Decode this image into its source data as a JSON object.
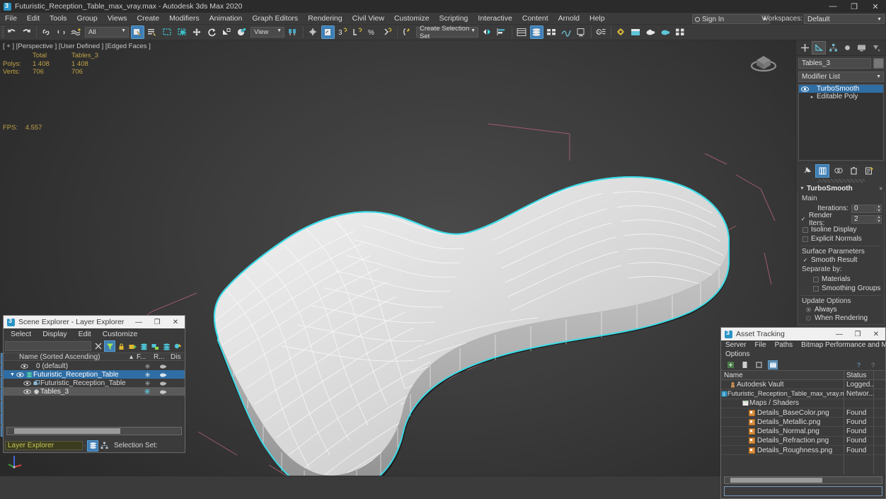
{
  "titlebar": {
    "title": "Futuristic_Reception_Table_max_vray.max - Autodesk 3ds Max 2020",
    "minimize": "—",
    "maximize": "❐",
    "close": "✕"
  },
  "menubar": {
    "items": [
      "File",
      "Edit",
      "Tools",
      "Group",
      "Views",
      "Create",
      "Modifiers",
      "Animation",
      "Graph Editors",
      "Rendering",
      "Civil View",
      "Customize",
      "Scripting",
      "Interactive",
      "Content",
      "Arnold",
      "Help"
    ],
    "signin_label": "Sign In",
    "workspaces_label": "Workspaces:",
    "workspace_value": "Default"
  },
  "toolbar": {
    "selection_filter": "All",
    "reference_coord": "View",
    "named_selection_set": "Create Selection Set"
  },
  "viewport": {
    "label": "[ + ] [Perspective ] [User Defined ] [Edged Faces ]",
    "stats": {
      "col_total": "Total",
      "col_object": "Tables_3",
      "rows": [
        {
          "label": "Polys:",
          "total": "1 408",
          "object": "1 408"
        },
        {
          "label": "Verts:",
          "total": "706",
          "object": "706"
        }
      ],
      "fps_label": "FPS:",
      "fps_value": "4.557"
    }
  },
  "command_panel": {
    "object_name": "Tables_3",
    "modifier_list_label": "Modifier List",
    "stack": [
      {
        "label": "TurboSmooth",
        "selected": true
      },
      {
        "label": "Editable Poly",
        "selected": false
      }
    ],
    "rollout": {
      "title": "TurboSmooth",
      "main_label": "Main",
      "iterations_label": "Iterations:",
      "iterations_value": "0",
      "render_iters_label": "Render Iters:",
      "render_iters_value": "2",
      "isoline_display": "Isoline Display",
      "explicit_normals": "Explicit Normals",
      "surface_parameters": "Surface Parameters",
      "smooth_result": "Smooth Result",
      "separate_by": "Separate by:",
      "materials": "Materials",
      "smoothing_groups": "Smoothing Groups",
      "update_options": "Update Options",
      "always": "Always",
      "when_rendering": "When Rendering"
    }
  },
  "scene_explorer": {
    "title": "Scene Explorer - Layer Explorer",
    "minimize": "—",
    "maximize": "❐",
    "close": "✕",
    "menu": [
      "Select",
      "Display",
      "Edit",
      "Customize"
    ],
    "search_value": "",
    "columns": {
      "name": "Name (Sorted Ascending)",
      "sort_marker": "▴",
      "frozen": "F...",
      "render": "R...",
      "display": "Dis"
    },
    "rows": [
      {
        "label": "0 (default)",
        "indent": 1,
        "state": "normal"
      },
      {
        "label": "Futuristic_Reception_Table",
        "indent": 1,
        "state": "selected"
      },
      {
        "label": "Futuristic_Reception_Table",
        "indent": 2,
        "state": "normal"
      },
      {
        "label": "Tables_3",
        "indent": 2,
        "state": "highlight"
      }
    ],
    "status_combo": "Layer Explorer",
    "selection_set_label": "Selection Set:"
  },
  "asset_tracking": {
    "title": "Asset Tracking",
    "minimize": "—",
    "maximize": "❐",
    "close": "✕",
    "menu": [
      "Server",
      "File",
      "Paths",
      "Bitmap Performance and Memory",
      "Options"
    ],
    "columns": {
      "name": "Name",
      "status": "Status"
    },
    "rows": [
      {
        "name": "Autodesk Vault",
        "status": "Logged...",
        "indent": 1,
        "icon": "vault-icon"
      },
      {
        "name": "Futuristic_Reception_Table_max_vray.max",
        "status": "Networ...",
        "indent": 2,
        "icon": "max-file-icon"
      },
      {
        "name": "Maps / Shaders",
        "status": "",
        "indent": 3,
        "icon": "maps-icon"
      },
      {
        "name": "Details_BaseColor.png",
        "status": "Found",
        "indent": 4,
        "icon": "png-icon"
      },
      {
        "name": "Details_Metallic.png",
        "status": "Found",
        "indent": 4,
        "icon": "png-icon"
      },
      {
        "name": "Details_Normal.png",
        "status": "Found",
        "indent": 4,
        "icon": "png-icon"
      },
      {
        "name": "Details_Refraction.png",
        "status": "Found",
        "indent": 4,
        "icon": "png-icon"
      },
      {
        "name": "Details_Roughness.png",
        "status": "Found",
        "indent": 4,
        "icon": "png-icon"
      }
    ]
  },
  "colors": {
    "selection_highlight": "#3ddbe8",
    "accent_blue": "#2f6ea5",
    "stats_yellow": "#c0a245",
    "panel_bg": "#3b3b3b",
    "helper_pink": "#b06a7a"
  }
}
